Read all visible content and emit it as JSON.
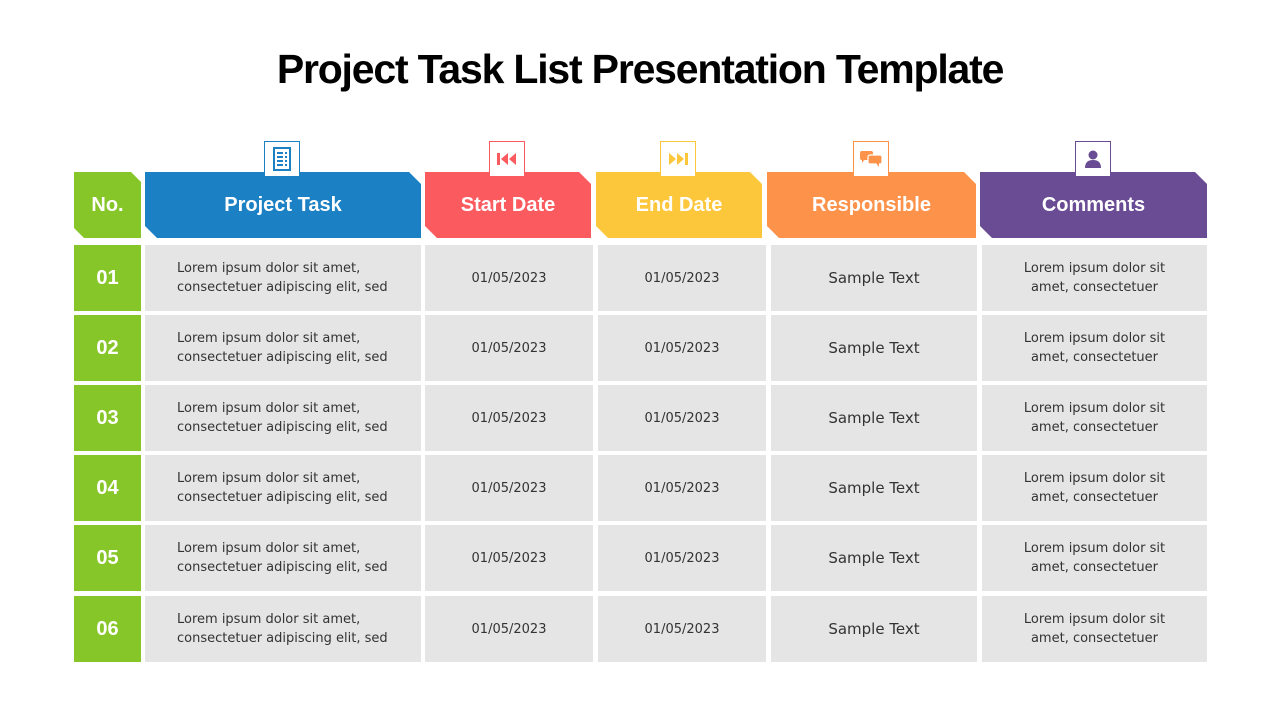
{
  "title": "Project Task List Presentation Template",
  "colors": {
    "no": "#86c628",
    "project_task": "#1b80c4",
    "start_date": "#fb5a5f",
    "end_date": "#fdc73b",
    "responsible": "#fd924b",
    "comments": "#694c94",
    "cell_bg": "#e6e5e6"
  },
  "headers": {
    "no": "No.",
    "project_task": "Project Task",
    "start_date": "Start Date",
    "end_date": "End Date",
    "responsible": "Responsible",
    "comments": "Comments"
  },
  "header_icons": {
    "project_task": "checklist-icon",
    "start_date": "rewind-icon",
    "end_date": "fast-forward-icon",
    "responsible": "chat-bubbles-icon",
    "comments": "person-icon"
  },
  "rows": [
    {
      "no": "01",
      "task_line1": "Lorem ipsum dolor sit amet,",
      "task_line2": "consectetuer adipiscing elit, sed",
      "start": "01/05/2023",
      "end": "01/05/2023",
      "responsible": "Sample Text",
      "comment_line1": "Lorem ipsum dolor sit",
      "comment_line2": "amet, consectetuer"
    },
    {
      "no": "02",
      "task_line1": "Lorem ipsum dolor sit amet,",
      "task_line2": "consectetuer adipiscing elit, sed",
      "start": "01/05/2023",
      "end": "01/05/2023",
      "responsible": "Sample Text",
      "comment_line1": "Lorem ipsum dolor sit",
      "comment_line2": "amet, consectetuer"
    },
    {
      "no": "03",
      "task_line1": "Lorem ipsum dolor sit amet,",
      "task_line2": "consectetuer adipiscing elit, sed",
      "start": "01/05/2023",
      "end": "01/05/2023",
      "responsible": "Sample Text",
      "comment_line1": "Lorem ipsum dolor sit",
      "comment_line2": "amet, consectetuer"
    },
    {
      "no": "04",
      "task_line1": "Lorem ipsum dolor sit amet,",
      "task_line2": "consectetuer adipiscing elit, sed",
      "start": "01/05/2023",
      "end": "01/05/2023",
      "responsible": "Sample Text",
      "comment_line1": "Lorem ipsum dolor sit",
      "comment_line2": "amet, consectetuer"
    },
    {
      "no": "05",
      "task_line1": "Lorem ipsum dolor sit amet,",
      "task_line2": "consectetuer adipiscing elit, sed",
      "start": "01/05/2023",
      "end": "01/05/2023",
      "responsible": "Sample Text",
      "comment_line1": "Lorem ipsum dolor sit",
      "comment_line2": "amet, consectetuer"
    },
    {
      "no": "06",
      "task_line1": "Lorem ipsum dolor sit amet,",
      "task_line2": "consectetuer adipiscing elit, sed",
      "start": "01/05/2023",
      "end": "01/05/2023",
      "responsible": "Sample Text",
      "comment_line1": "Lorem ipsum dolor sit",
      "comment_line2": "amet, consectetuer"
    }
  ]
}
